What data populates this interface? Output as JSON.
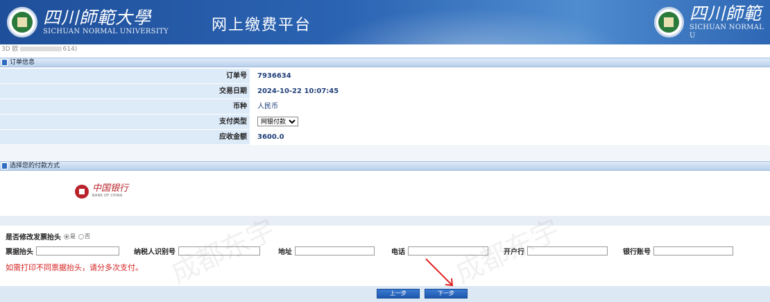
{
  "header": {
    "uni_cn": "四川師範大學",
    "uni_en": "SICHUAN NORMAL UNIVERSITY",
    "platform_title": "网上缴费平台",
    "uni_cn_right": "四川師範",
    "uni_en_right": "SICHUAN NORMAL U"
  },
  "user_line": {
    "prefix": "3D 欧",
    "suffix": "614)"
  },
  "order_section": {
    "title": "订单信息",
    "rows": [
      {
        "label": "订单号",
        "value": "7936634"
      },
      {
        "label": "交易日期",
        "value": "2024-10-22 10:07:45"
      },
      {
        "label": "币种",
        "value": "人民币"
      },
      {
        "label": "支付类型",
        "select_value": "网银付款"
      },
      {
        "label": "应收金额",
        "value": "3600.0"
      }
    ]
  },
  "payment_section": {
    "title": "选择您的付款方式"
  },
  "bank": {
    "cn": "中国银行",
    "en": "BANK OF CHINA"
  },
  "invoice": {
    "question": "是否修改发票抬头",
    "yes": "是",
    "no": "否",
    "fields": [
      {
        "label": "票据抬头",
        "value": ""
      },
      {
        "label": "纳税人识别号",
        "value": ""
      },
      {
        "label": "地址",
        "value": ""
      },
      {
        "label": "电话",
        "value": ""
      },
      {
        "label": "开户行",
        "value": ""
      },
      {
        "label": "银行账号",
        "value": ""
      }
    ],
    "note": "如需打印不同票据抬头，请分多次支付。"
  },
  "buttons": {
    "prev": "上一步",
    "next": "下一步"
  },
  "watermarks": [
    "成都东宇",
    "成都东宇"
  ],
  "colors": {
    "banner": "#2b64b3",
    "note": "#d42020",
    "value_text": "#1f3f7a",
    "accent": "#2d6cc0"
  }
}
